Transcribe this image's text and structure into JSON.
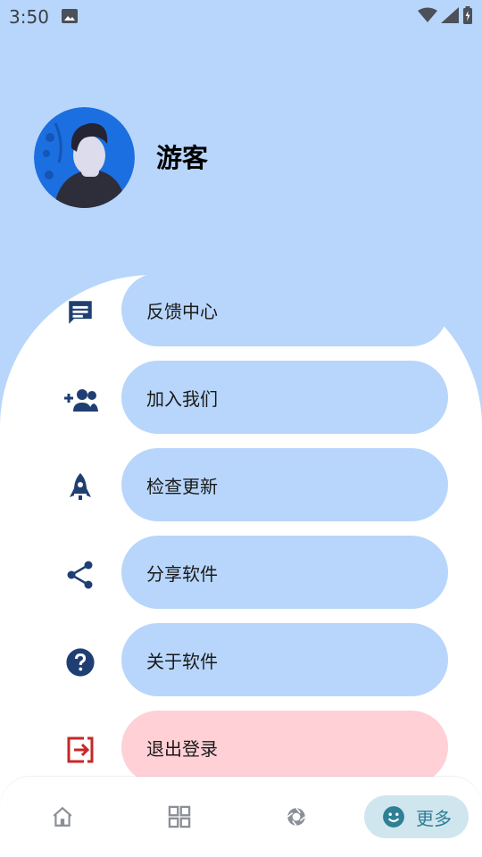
{
  "status_bar": {
    "time": "3:50",
    "icons": [
      "gallery-icon",
      "wifi-icon",
      "signal-icon",
      "battery-icon"
    ]
  },
  "profile": {
    "name": "游客",
    "avatar_icon": "user-avatar-illustration"
  },
  "menu": {
    "items": [
      {
        "label": "反馈中心",
        "icon": "message-icon"
      },
      {
        "label": "加入我们",
        "icon": "add-group-icon"
      },
      {
        "label": "检查更新",
        "icon": "rocket-icon"
      },
      {
        "label": "分享软件",
        "icon": "share-icon"
      },
      {
        "label": "关于软件",
        "icon": "help-icon"
      },
      {
        "label": "退出登录",
        "icon": "logout-icon"
      }
    ]
  },
  "bottom_nav": {
    "items": [
      {
        "icon": "home-icon"
      },
      {
        "icon": "grid-icon"
      },
      {
        "icon": "aperture-icon"
      },
      {
        "icon": "smile-icon",
        "label": "更多",
        "selected": true
      }
    ]
  },
  "colors": {
    "background": "#b8d6fb",
    "pill": "#b8d6fb",
    "logout_pill": "#ffd0d6",
    "icon": "#1f3f73",
    "logout_icon": "#c62828",
    "active_nav": "#2f7f95"
  }
}
